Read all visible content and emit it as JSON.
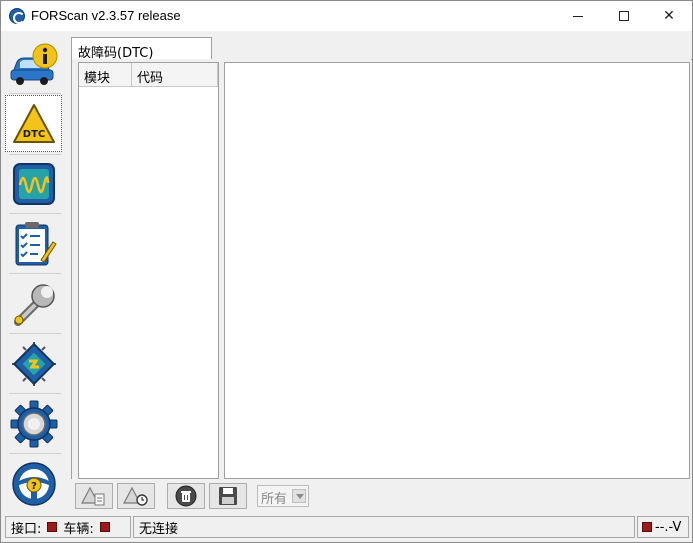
{
  "window": {
    "title": "FORScan v2.3.57 release",
    "minimize_label": "",
    "close_label": "✕"
  },
  "sidebar": {
    "items": [
      {
        "name": "vehicle-info",
        "icon": "car-info-icon"
      },
      {
        "name": "dtc",
        "icon": "dtc-warning-icon",
        "active": true
      },
      {
        "name": "oscilloscope",
        "icon": "oscilloscope-icon"
      },
      {
        "name": "tests",
        "icon": "checklist-icon"
      },
      {
        "name": "service",
        "icon": "wrench-icon"
      },
      {
        "name": "configuration",
        "icon": "chip-icon"
      },
      {
        "name": "settings",
        "icon": "gear-icon"
      },
      {
        "name": "help",
        "icon": "steering-help-icon"
      }
    ]
  },
  "main": {
    "tab_label": "故障码(DTC)",
    "columns": [
      "模块",
      "代码"
    ]
  },
  "actions": {
    "filter_value": "所有"
  },
  "status": {
    "interface_label": "接口:",
    "vehicle_label": "车辆:",
    "connection_text": "无连接",
    "voltage_text": "--.-V"
  },
  "colors": {
    "led_off": "#9d1a1a",
    "accent_blue": "#1f5fa8",
    "accent_yellow": "#f2c318"
  }
}
